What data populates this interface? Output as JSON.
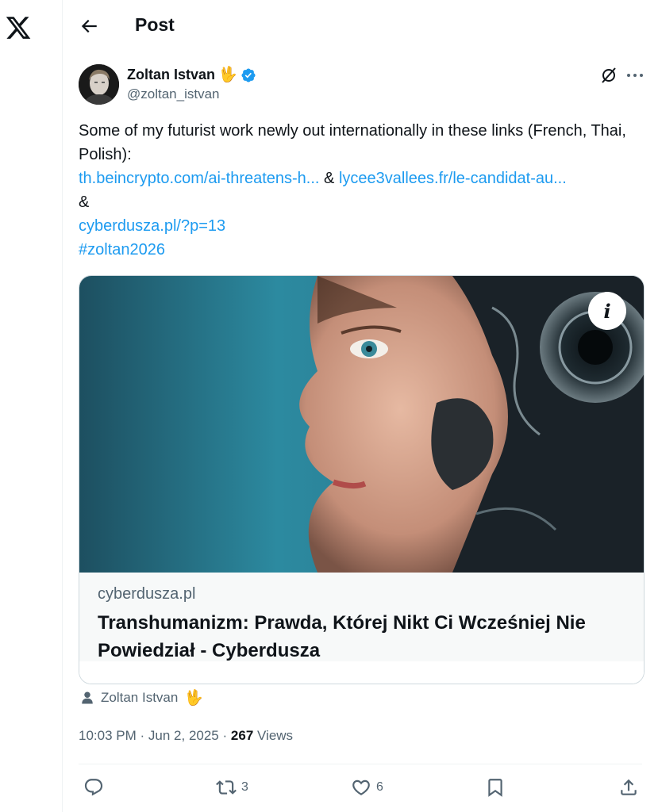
{
  "sidebar": {
    "logo_icon": "x-logo-icon"
  },
  "header": {
    "title": "Post",
    "back_icon": "arrow-left-icon"
  },
  "tweet": {
    "author_name": "Zoltan Istvan",
    "author_emoji": "🖖",
    "handle": "@zoltan_istvan",
    "verified": true,
    "text_line1": "Some of my futurist work newly out internationally in these links (French, Thai, Polish):",
    "link1": "th.beincrypto.com/ai-threatens-h...",
    "amp1": "&",
    "link2": "lycee3vallees.fr/le-candidat-au...",
    "amp2": "&",
    "link3": "cyberdusza.pl/?p=13",
    "hashtag": "#zoltan2026"
  },
  "card": {
    "domain": "cyberdusza.pl",
    "title": "Transhumanizm: Prawda, Której Nikt Ci Wcześniej Nie Powiedział - Cyberdusza",
    "info_label": "i"
  },
  "attribution": {
    "name": "Zoltan Istvan",
    "emoji": "🖖"
  },
  "meta": {
    "time": "10:03 PM",
    "sep1": "·",
    "date": "Jun 2, 2025",
    "sep2": "·",
    "views_count": "267",
    "views_label": "Views"
  },
  "actions": {
    "reply_count": "",
    "repost_count": "3",
    "like_count": "6",
    "bookmark_count": "",
    "share_count": ""
  },
  "colors": {
    "accent": "#1d9bf0",
    "text_primary": "#0f1419",
    "text_secondary": "#536471",
    "border": "#cfd9de"
  }
}
